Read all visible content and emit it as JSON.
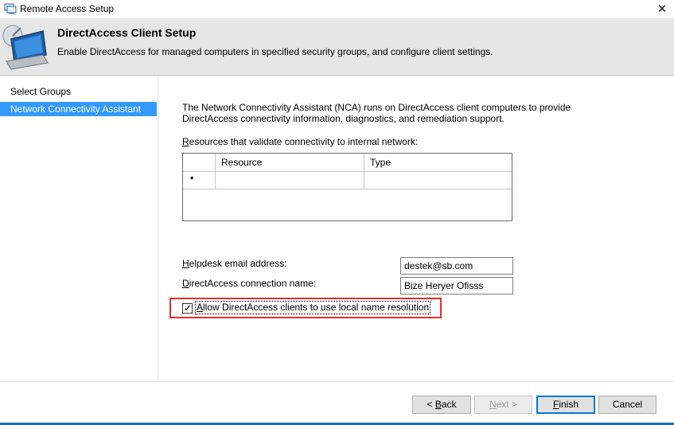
{
  "window": {
    "title": "Remote Access Setup",
    "close_glyph": "✕",
    "accent_color": "#1e6fb8"
  },
  "header": {
    "title": "DirectAccess Client Setup",
    "subtitle": "Enable DirectAccess for managed computers in specified security groups, and configure client settings.",
    "icon": "laptop-satellite-icon"
  },
  "nav": {
    "items": [
      {
        "label": "Select Groups",
        "selected": false
      },
      {
        "label": "Network Connectivity Assistant",
        "selected": true
      }
    ],
    "selected_color": "#3399ff"
  },
  "main": {
    "intro": "The Network Connectivity Assistant (NCA) runs on DirectAccess client computers to provide DirectAccess connectivity information, diagnostics, and remediation support.",
    "resources_label": "Resources that validate connectivity to internal network:",
    "grid": {
      "columns": [
        "",
        "Resource",
        "Type"
      ],
      "new_row_marker": "*"
    },
    "helpdesk_label": "Helpdesk email address:",
    "helpdesk_value": "destek@sb.com",
    "connection_label": "DirectAccess connection name:",
    "connection_value": "Bize Heryer Ofisss",
    "local_name_resolution": {
      "label": "Allow DirectAccess clients to use local name resolution",
      "checked": true,
      "check_glyph": "✓",
      "highlight_color": "#e03030"
    }
  },
  "footer": {
    "back_label": "< Back",
    "next_label": "Next >",
    "finish_label": "Finish",
    "cancel_label": "Cancel"
  }
}
